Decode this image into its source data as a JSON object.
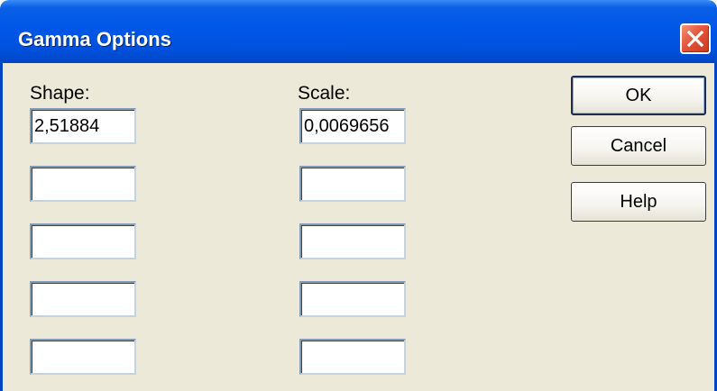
{
  "window": {
    "title": "Gamma Options",
    "close_icon": "close-icon"
  },
  "form": {
    "shape_label": "Shape:",
    "scale_label": "Scale:",
    "shape_values": [
      "2,51884",
      "",
      "",
      "",
      ""
    ],
    "scale_values": [
      "0,0069656",
      "",
      "",
      "",
      ""
    ]
  },
  "buttons": {
    "ok": "OK",
    "cancel": "Cancel",
    "help": "Help"
  },
  "colors": {
    "titlebar": "#0057e7",
    "close_button": "#e4553b",
    "dialog_background": "#ece9d8",
    "field_border": "#7f9db9"
  }
}
